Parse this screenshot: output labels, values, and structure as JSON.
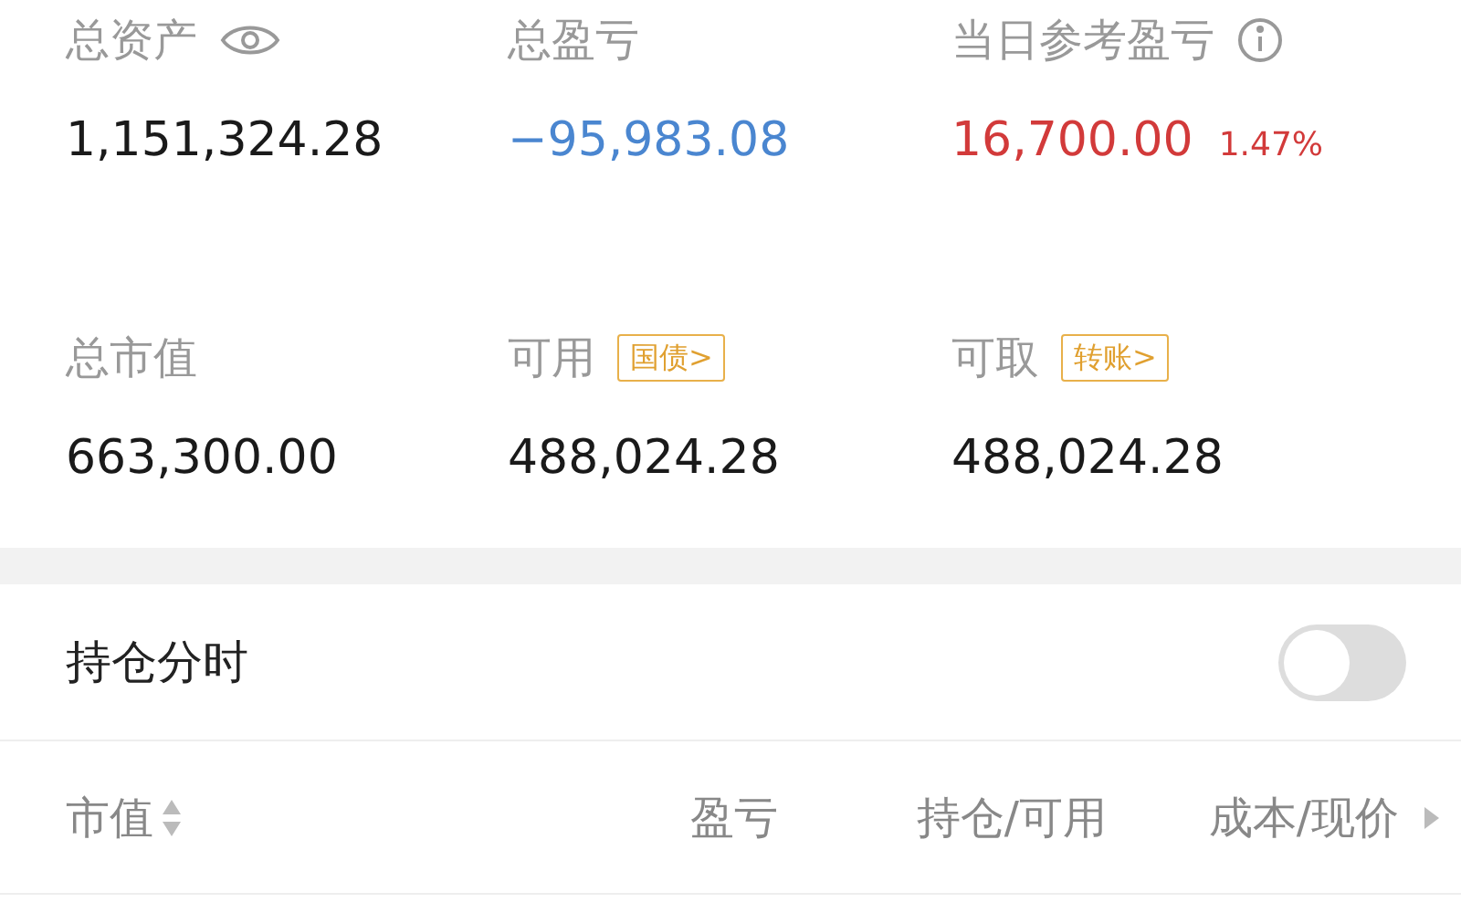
{
  "stats": [
    {
      "label": "总资产",
      "value": "1,151,324.28",
      "color": "#1a1a1a"
    },
    {
      "label": "总盈亏",
      "value": "−95,983.08",
      "color": "#4a86d0"
    },
    {
      "label": "当日参考盈亏",
      "value": "16,700.00",
      "color": "#d23a3a",
      "percent": "1.47%"
    },
    {
      "label": "总市值",
      "value": "663,300.00",
      "color": "#1a1a1a"
    },
    {
      "label": "可用",
      "value": "488,024.28",
      "color": "#1a1a1a",
      "tag": "国债>"
    },
    {
      "label": "可取",
      "value": "488,024.28",
      "color": "#1a1a1a",
      "tag": "转账>"
    }
  ],
  "toggle": {
    "label": "持仓分时",
    "on": false
  },
  "columns": [
    {
      "label": "市值",
      "kind": "sortable"
    },
    {
      "label": "盈亏",
      "kind": "plain"
    },
    {
      "label": "持仓/可用",
      "kind": "plain"
    },
    {
      "label": "成本/现价",
      "kind": "more"
    }
  ]
}
